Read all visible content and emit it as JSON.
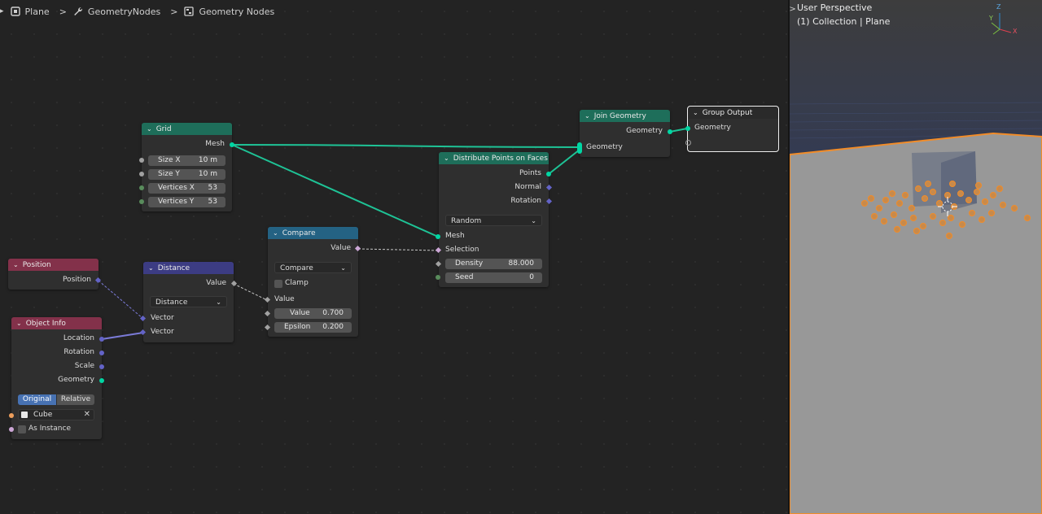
{
  "breadcrumb": {
    "items": [
      "Plane",
      "GeometryNodes",
      "Geometry Nodes"
    ],
    "separator": ">"
  },
  "nodes": {
    "grid": {
      "title": "Grid",
      "out_mesh": "Mesh",
      "size_x_label": "Size X",
      "size_x_value": "10 m",
      "size_y_label": "Size Y",
      "size_y_value": "10 m",
      "vertices_x_label": "Vertices X",
      "vertices_x_value": "53",
      "vertices_y_label": "Vertices Y",
      "vertices_y_value": "53"
    },
    "position": {
      "title": "Position",
      "out_position": "Position"
    },
    "object_info": {
      "title": "Object Info",
      "out_location": "Location",
      "out_rotation": "Rotation",
      "out_scale": "Scale",
      "out_geometry": "Geometry",
      "mode_original": "Original",
      "mode_relative": "Relative",
      "object_name": "Cube",
      "as_instance": "As Instance"
    },
    "distance": {
      "title": "Distance",
      "out_value": "Value",
      "mode": "Distance",
      "in_vector_1": "Vector",
      "in_vector_2": "Vector"
    },
    "compare": {
      "title": "Compare",
      "out_value": "Value",
      "mode": "Compare",
      "clamp": "Clamp",
      "in_value": "Value",
      "value_label": "Value",
      "value_value": "0.700",
      "epsilon_label": "Epsilon",
      "epsilon_value": "0.200"
    },
    "distribute": {
      "title": "Distribute Points on Faces",
      "out_points": "Points",
      "out_normal": "Normal",
      "out_rotation": "Rotation",
      "mode": "Random",
      "in_mesh": "Mesh",
      "in_selection": "Selection",
      "density_label": "Density",
      "density_value": "88.000",
      "seed_label": "Seed",
      "seed_value": "0"
    },
    "join": {
      "title": "Join Geometry",
      "out_geometry": "Geometry",
      "in_geometry": "Geometry"
    },
    "group_output": {
      "title": "Group Output",
      "in_geometry": "Geometry"
    }
  },
  "viewport": {
    "view_name": "User Perspective",
    "collection_info": "(1) Collection | Plane",
    "axis_z": "Z",
    "axis_y": "Y",
    "axis_x": "X"
  },
  "colors": {
    "geometry_socket": "#00d6a3",
    "vector_socket": "#6363c7",
    "float_socket": "#a1a1a1",
    "bool_socket": "#cca6d6",
    "int_socket": "#598c5c",
    "object_socket": "#ed9e5c",
    "header_geometry": "#1e6e5a",
    "header_input": "#83314a",
    "header_vector": "#3c3c83",
    "header_converter": "#246283",
    "selection_outline": "#f0f0f0",
    "object_highlight": "#f28c28"
  }
}
